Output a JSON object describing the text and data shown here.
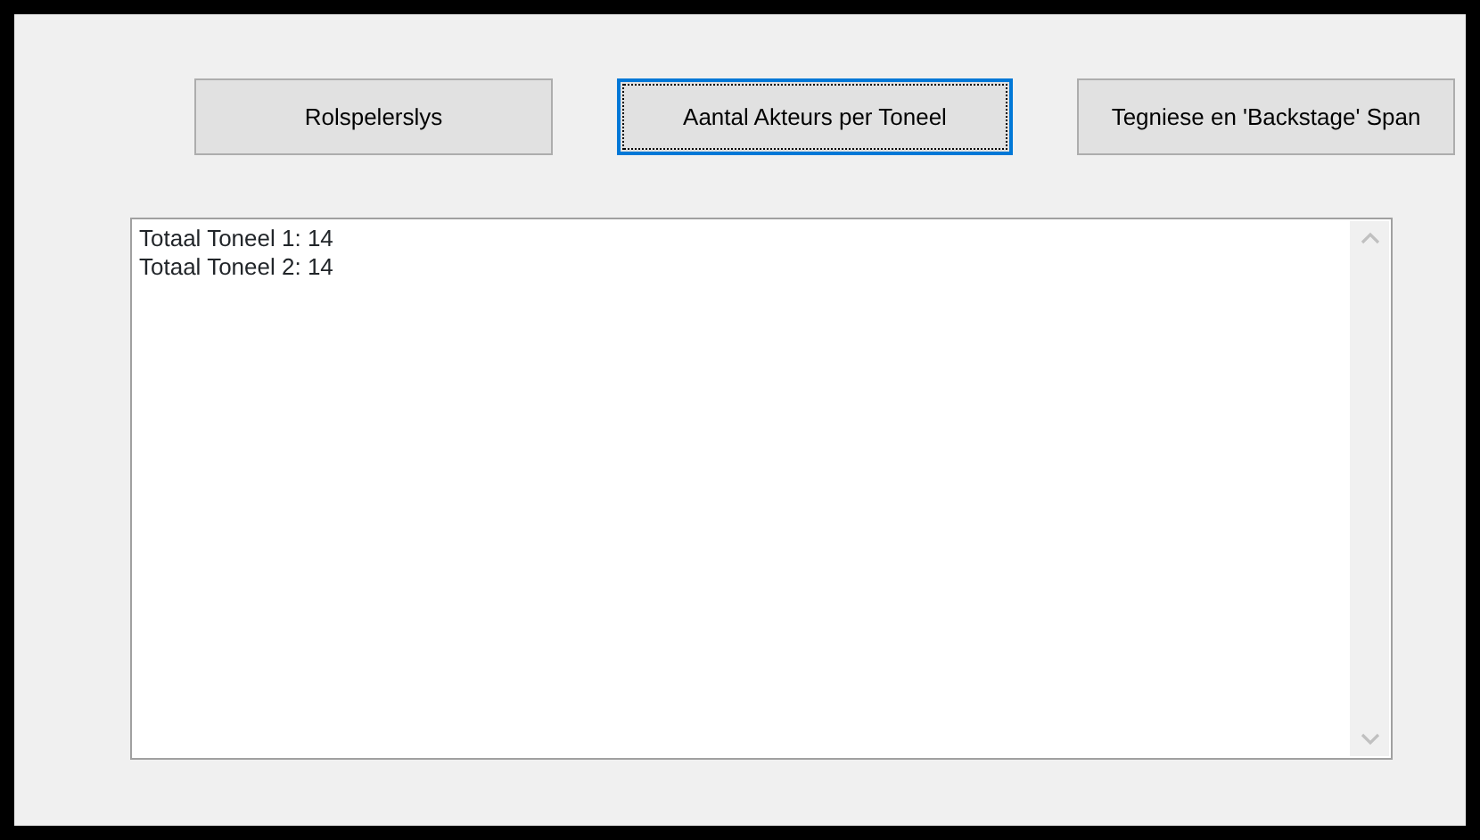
{
  "buttons": [
    {
      "label": "Rolspelerslys",
      "selected": false
    },
    {
      "label": "Aantal Akteurs per Toneel",
      "selected": true
    },
    {
      "label": "Tegniese en 'Backstage' Span",
      "selected": false
    }
  ],
  "list_box": {
    "lines": [
      "Totaal Toneel 1: 14",
      "Totaal Toneel 2: 14"
    ]
  }
}
